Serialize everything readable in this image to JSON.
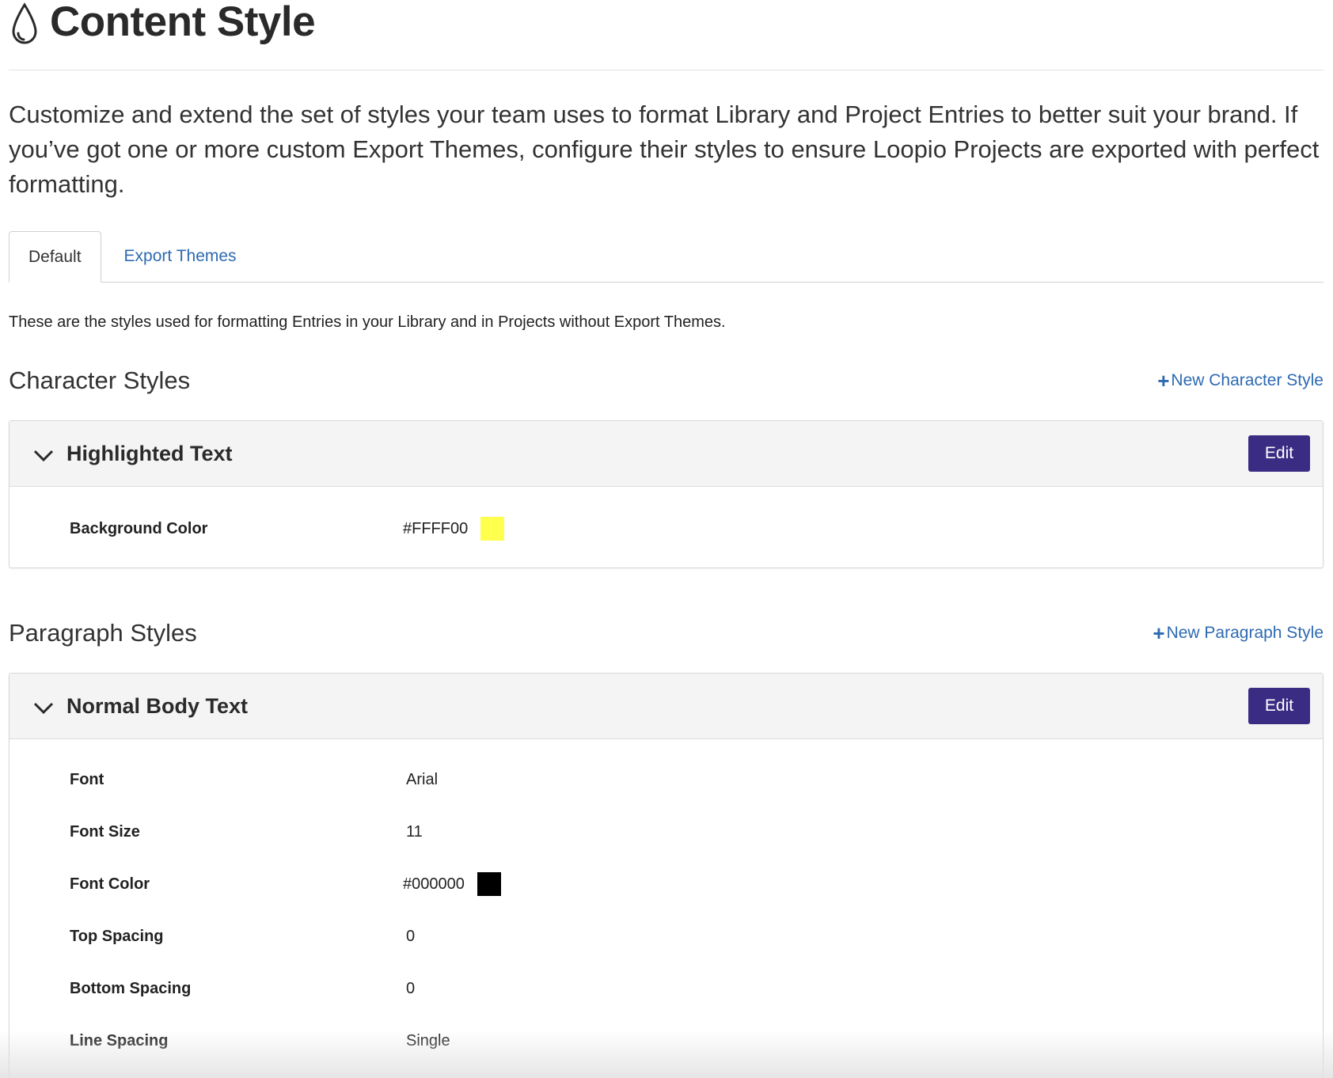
{
  "header": {
    "title": "Content Style",
    "icon": "drop-icon"
  },
  "intro": "Customize and extend the set of styles your team uses to format Library and Project Entries to better suit your brand. If you’ve got one or more custom Export Themes, configure their styles to ensure Loopio Projects are exported with perfect formatting.",
  "tabs": [
    {
      "label": "Default",
      "active": true
    },
    {
      "label": "Export Themes",
      "active": false
    }
  ],
  "description": "These are the styles used for formatting Entries in your Library and in Projects without Export Themes.",
  "character_styles": {
    "heading": "Character Styles",
    "new_label": "New Character Style",
    "items": [
      {
        "name": "Highlighted Text",
        "edit_label": "Edit",
        "properties": [
          {
            "label": "Background Color",
            "value": "#FFFF00",
            "swatch": "#FFFF4D"
          }
        ]
      }
    ]
  },
  "paragraph_styles": {
    "heading": "Paragraph Styles",
    "new_label": "New Paragraph Style",
    "items": [
      {
        "name": "Normal Body Text",
        "edit_label": "Edit",
        "properties": [
          {
            "label": "Font",
            "value": "Arial"
          },
          {
            "label": "Font Size",
            "value": "11"
          },
          {
            "label": "Font Color",
            "value": "#000000",
            "swatch": "#000000"
          },
          {
            "label": "Top Spacing",
            "value": "0"
          },
          {
            "label": "Bottom Spacing",
            "value": "0"
          },
          {
            "label": "Line Spacing",
            "value": "Single"
          }
        ]
      }
    ]
  },
  "colors": {
    "accent_button": "#3b2c83",
    "link": "#2e6ab1"
  }
}
